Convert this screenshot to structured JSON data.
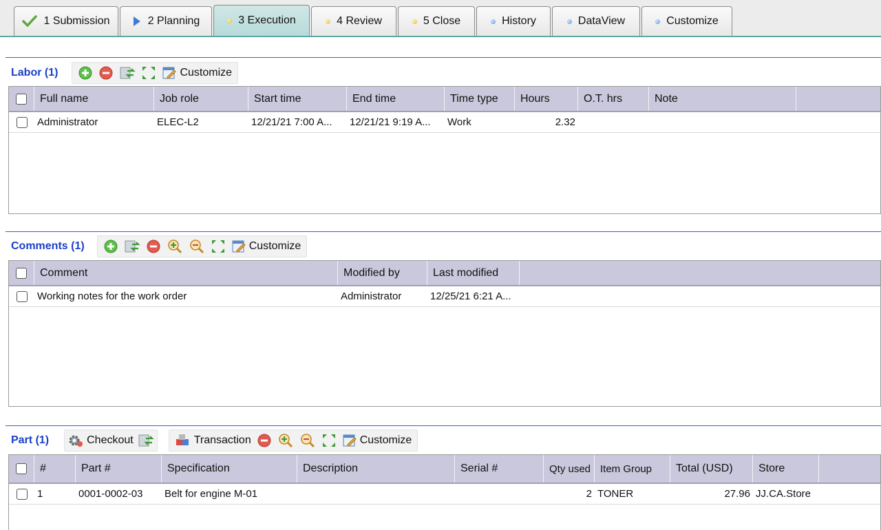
{
  "tabs": [
    {
      "label": "1 Submission",
      "icon": "check-icon"
    },
    {
      "label": "2 Planning",
      "icon": "play-arrow-icon"
    },
    {
      "label": "3 Execution",
      "icon": "yellow-dot-icon",
      "active": true
    },
    {
      "label": "4 Review",
      "icon": "yellow-dot-icon"
    },
    {
      "label": "5 Close",
      "icon": "yellow-dot-icon"
    },
    {
      "label": "History",
      "icon": "blue-dot-icon"
    },
    {
      "label": "DataView",
      "icon": "blue-dot-icon"
    },
    {
      "label": "Customize",
      "icon": "blue-dot-icon"
    }
  ],
  "labor": {
    "title": "Labor (1)",
    "customize_label": "Customize",
    "columns": [
      "Full name",
      "Job role",
      "Start time",
      "End time",
      "Time type",
      "Hours",
      "O.T. hrs",
      "Note"
    ],
    "rows": [
      {
        "full_name": "Administrator",
        "job_role": "ELEC-L2",
        "start": "12/21/21 7:00 A...",
        "end": "12/21/21 9:19 A...",
        "time_type": "Work",
        "hours": "2.32",
        "ot": "",
        "note": ""
      }
    ]
  },
  "comments": {
    "title": "Comments (1)",
    "customize_label": "Customize",
    "columns": [
      "Comment",
      "Modified by",
      "Last modified"
    ],
    "rows": [
      {
        "comment": "Working notes for the work order",
        "modified_by": "Administrator",
        "last_modified": "12/25/21 6:21 A..."
      }
    ]
  },
  "part": {
    "title": "Part (1)",
    "checkout_label": "Checkout",
    "transaction_label": "Transaction",
    "customize_label": "Customize",
    "columns": [
      "#",
      "Part #",
      "Specification",
      "Description",
      "Serial #",
      "Qty used",
      "Item Group",
      "Total (USD)",
      "Store"
    ],
    "rows": [
      {
        "num": "1",
        "part_no": "0001-0002-03",
        "spec": "Belt for engine M-01",
        "desc": "",
        "serial": "",
        "qty": "2",
        "group": "TONER",
        "total": "27.96",
        "store": "JJ.CA.Store"
      }
    ]
  },
  "colors": {
    "accent_title": "#1a3fc9",
    "header_bg": "#c9c8dc",
    "active_tab": "#b7dbd9"
  }
}
